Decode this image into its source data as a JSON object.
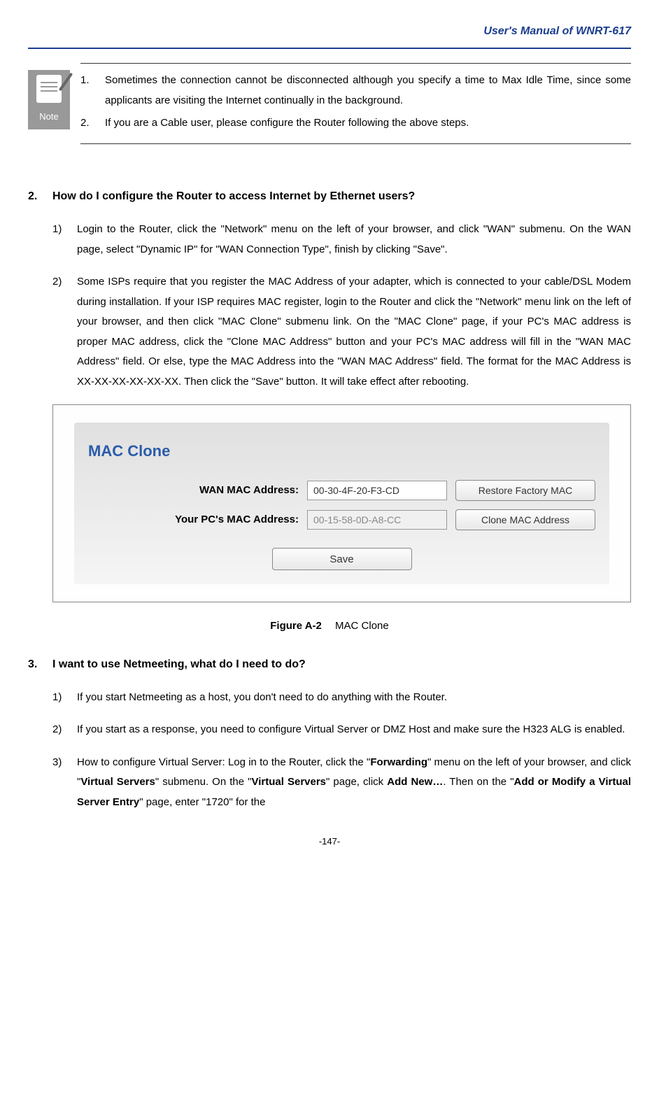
{
  "header": {
    "title": "User's Manual of WNRT-617"
  },
  "note": {
    "icon_label": "Note",
    "items": [
      {
        "num": "1.",
        "text": "Sometimes the connection cannot be disconnected although you specify a time to Max Idle Time, since some applicants are visiting the Internet continually in the background."
      },
      {
        "num": "2.",
        "text": "If you are a Cable user, please configure the Router following the above steps."
      }
    ]
  },
  "q2": {
    "num": "2.",
    "title": "How do I configure the Router to access Internet by Ethernet users?",
    "answers": [
      {
        "num": "1)",
        "text": "Login to the Router, click the \"Network\" menu on the left of your browser, and click \"WAN\" submenu. On the WAN page, select \"Dynamic IP\" for \"WAN Connection Type\", finish by clicking \"Save\"."
      },
      {
        "num": "2)",
        "text": "Some ISPs require that you register the MAC Address of your adapter, which is connected to your cable/DSL Modem during installation. If your ISP requires MAC register, login to the Router and click the \"Network\" menu link on the left of your browser, and then click \"MAC Clone\" submenu link. On the \"MAC Clone\" page, if your PC's MAC address is proper MAC address, click the \"Clone MAC Address\" button and your PC's MAC address will fill in the \"WAN MAC Address\" field. Or else, type the MAC Address into the \"WAN MAC Address\" field. The format for the MAC Address is XX-XX-XX-XX-XX-XX. Then click the \"Save\" button. It will take effect after rebooting."
      }
    ]
  },
  "figure": {
    "title": "MAC Clone",
    "row1_label": "WAN MAC Address:",
    "row1_value": "00-30-4F-20-F3-CD",
    "row1_button": "Restore Factory MAC",
    "row2_label": "Your PC's MAC Address:",
    "row2_value": "00-15-58-0D-A8-CC",
    "row2_button": "Clone MAC Address",
    "save_button": "Save",
    "caption_label": "Figure A-2",
    "caption_text": "MAC Clone"
  },
  "q3": {
    "num": "3.",
    "title": "I want to use Netmeeting, what do I need to do?",
    "answers": [
      {
        "num": "1)",
        "text": "If you start Netmeeting as a host, you don't need to do anything with the Router."
      },
      {
        "num": "2)",
        "text": "If you start as a response, you need to configure Virtual Server or DMZ Host and make sure the H323 ALG is enabled."
      },
      {
        "num": "3)",
        "html": "How to configure Virtual Server: Log in to the Router, click the \"<b>Forwarding</b>\" menu on the left of your browser, and click \"<b>Virtual Servers</b>\" submenu. On the \"<b>Virtual Servers</b>\" page, click <b>Add New…</b>. Then on the \"<b>Add or Modify a Virtual Server Entry</b>\" page, enter \"1720\" for the"
      }
    ]
  },
  "footer": "-147-"
}
